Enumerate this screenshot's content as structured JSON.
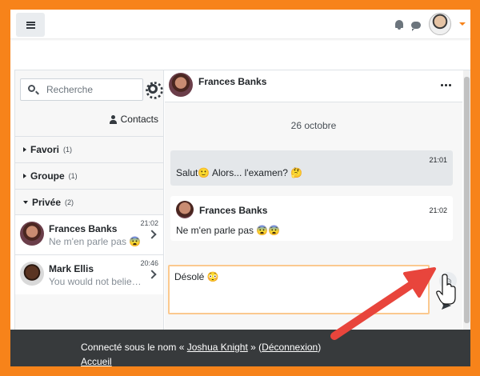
{
  "topnav": {
    "menu_icon": "hamburger-icon",
    "notification_icon": "bell-icon",
    "messages_icon": "chat-bubble-icon",
    "user_menu_icon": "caret-down-icon"
  },
  "search": {
    "placeholder": "Recherche"
  },
  "contacts_label": "Contacts",
  "sections": [
    {
      "title": "Favori",
      "count": "(1)",
      "expanded": false
    },
    {
      "title": "Groupe",
      "count": "(1)",
      "expanded": false
    },
    {
      "title": "Privée",
      "count": "(2)",
      "expanded": true
    }
  ],
  "conversations": [
    {
      "name": "Frances Banks",
      "time": "21:02",
      "preview": "Ne m'en parle pas 😨"
    },
    {
      "name": "Mark Ellis",
      "time": "20:46",
      "preview": "You would not believe it..."
    }
  ],
  "chat": {
    "contact_name": "Frances Banks",
    "date_separator": "26 octobre",
    "messages": [
      {
        "mine": true,
        "time": "21:01",
        "text": "Salut🙂 Alors... l'examen? 🤔"
      },
      {
        "mine": false,
        "sender": "Frances Banks",
        "time": "21:02",
        "text": "Ne m'en parle pas 😨😨"
      }
    ],
    "draft": "Désolé 😳"
  },
  "footer": {
    "logged_in_prefix": "Connecté sous le nom « ",
    "user_name": "Joshua Knight",
    "logged_in_middle": " » (",
    "logout_label": "Déconnexion",
    "logged_in_suffix": ")",
    "home_label": "Accueil"
  },
  "colors": {
    "border_orange": "#f7831a",
    "arrow_red": "#e8453c",
    "footer_bg": "#373a3c",
    "compose_focus": "#fbc98f"
  }
}
